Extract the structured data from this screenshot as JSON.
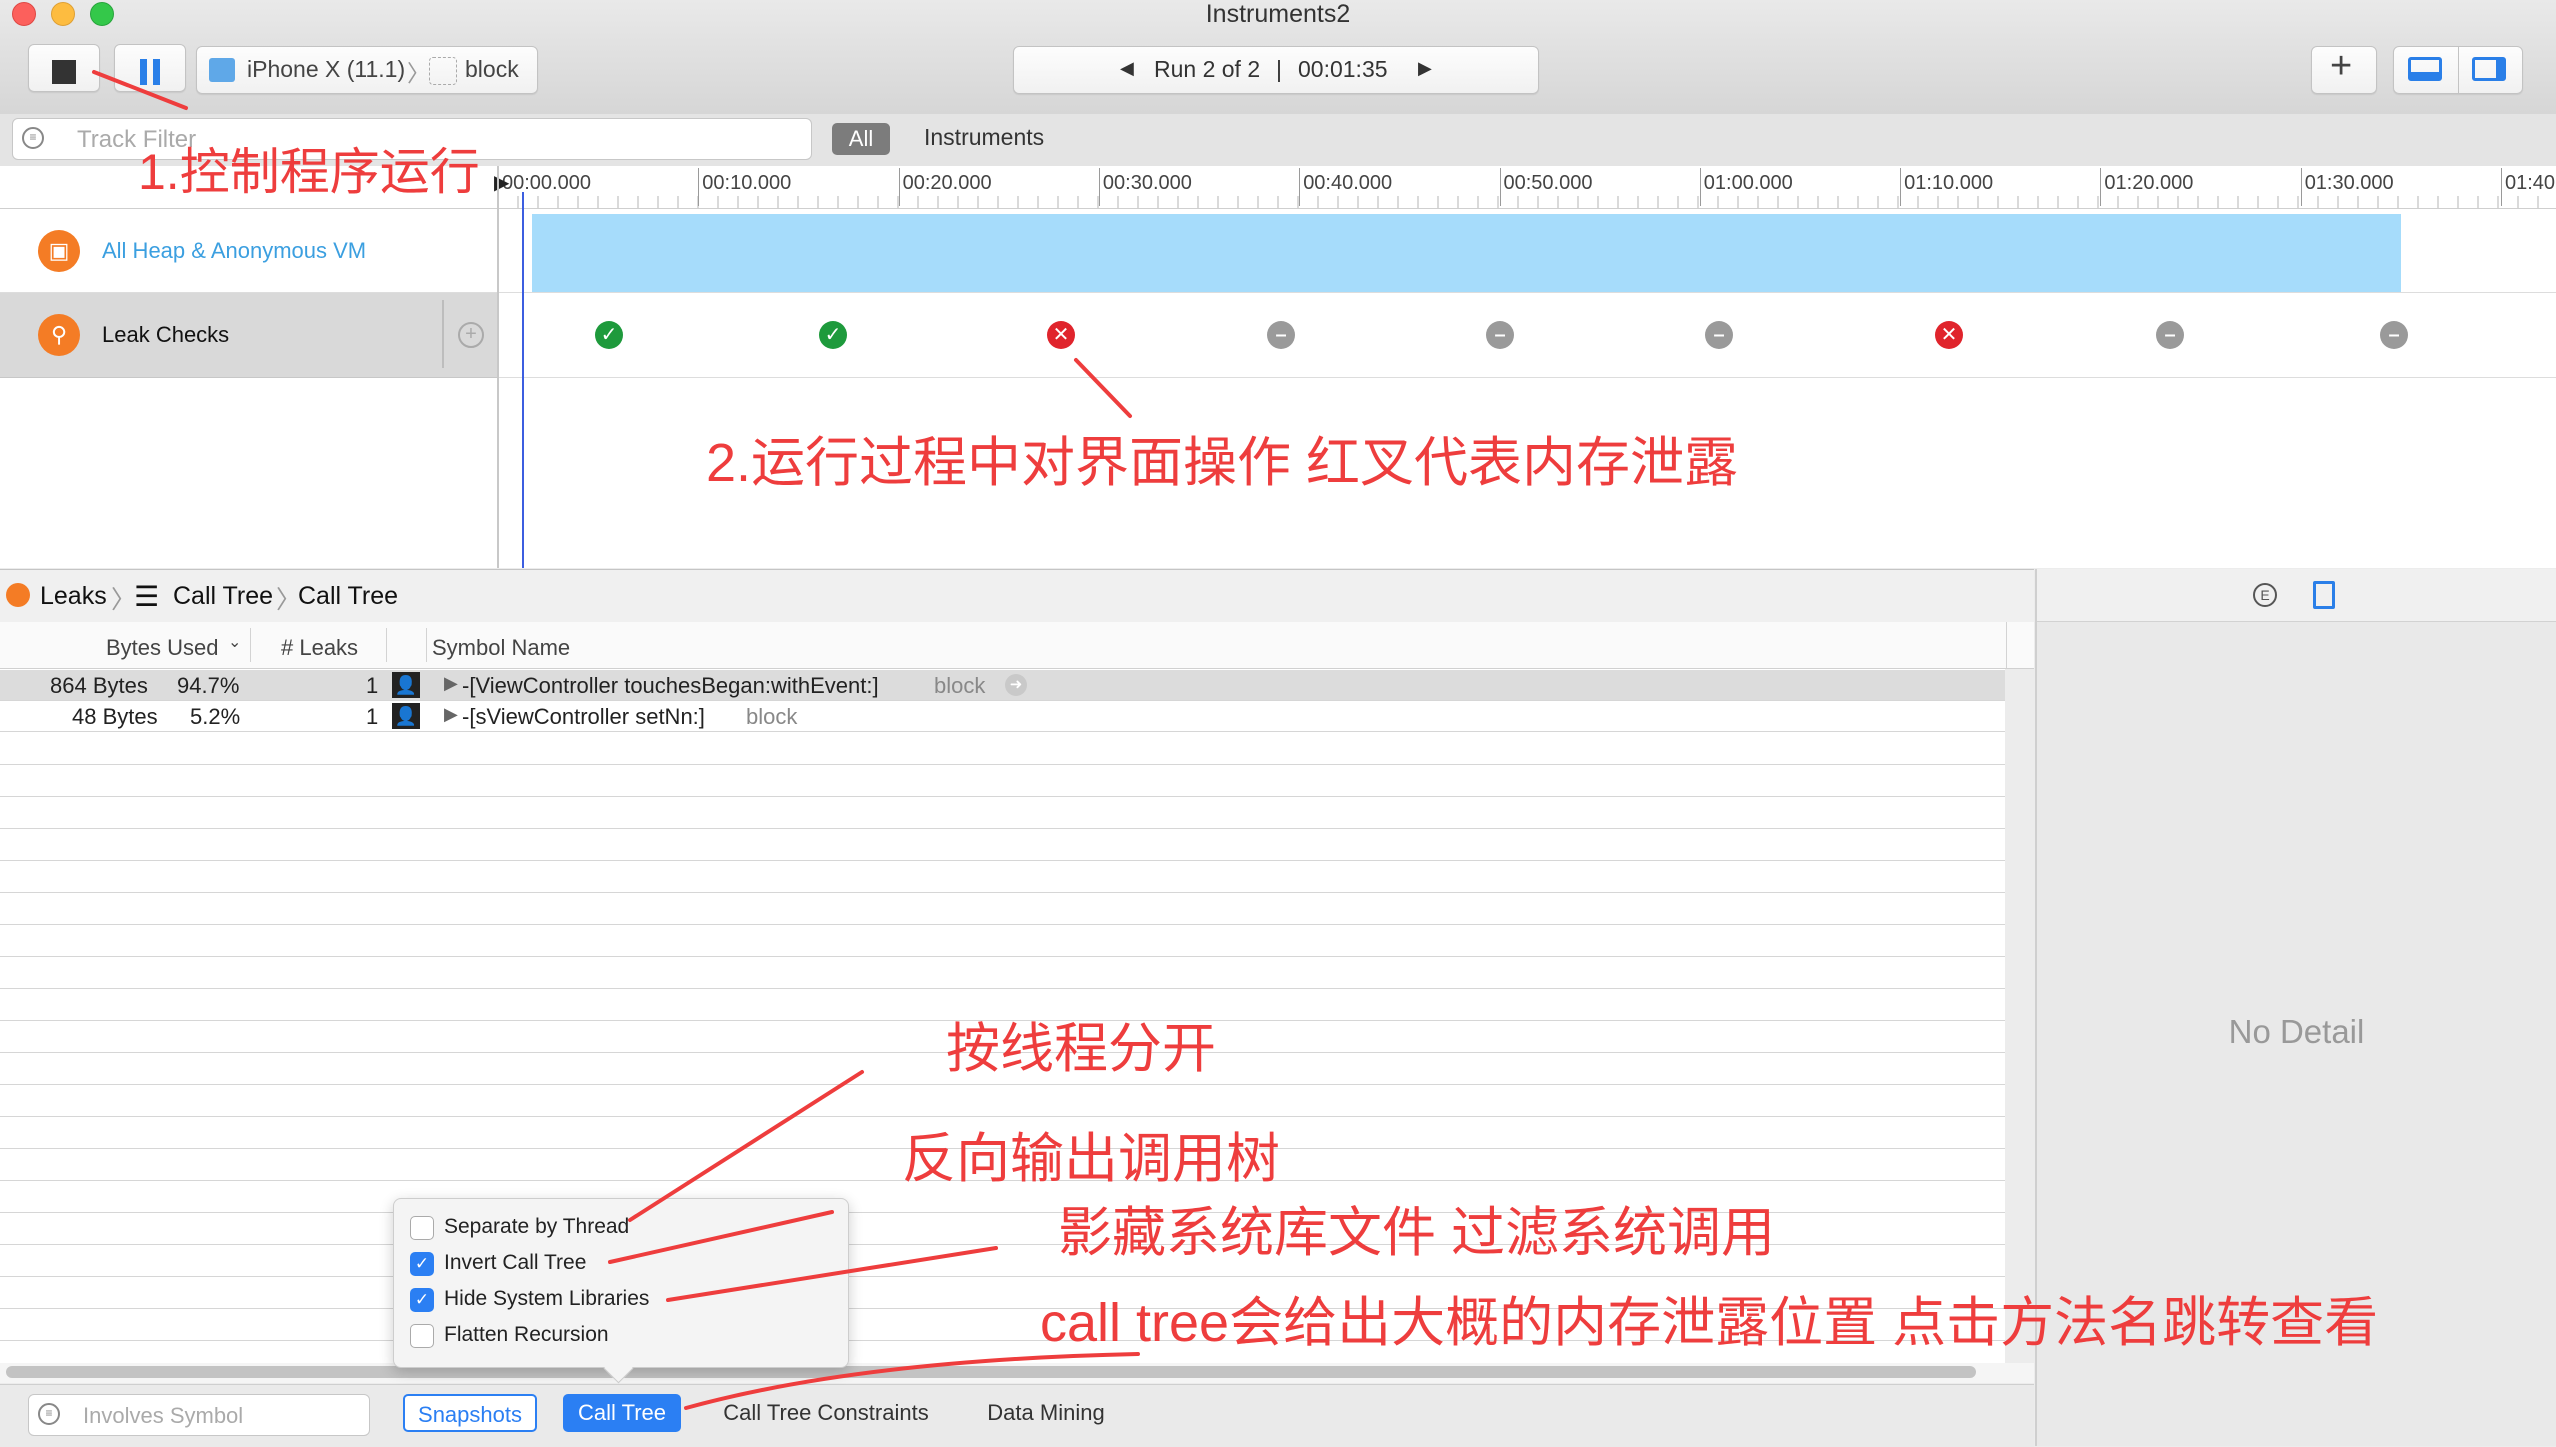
{
  "window": {
    "title": "Instruments2"
  },
  "toolbar": {
    "device": "iPhone X (11.1)",
    "target": "block",
    "run_label": "Run 2 of 2",
    "run_time": "00:01:35"
  },
  "filter_bar": {
    "track_filter_placeholder": "Track Filter",
    "scope_all": "All",
    "scope_instruments": "Instruments"
  },
  "timeline": {
    "ticks": [
      "00:00.000",
      "00:10.000",
      "00:20.000",
      "00:30.000",
      "00:40.000",
      "00:50.000",
      "01:00.000",
      "01:10.000",
      "01:20.000",
      "01:30.000",
      "01:40"
    ]
  },
  "tracks": [
    {
      "name": "All Heap & Anonymous VM",
      "icon": "heap-icon",
      "color": "#a6dcfb"
    },
    {
      "name": "Leak Checks",
      "icon": "leak-icon",
      "checks": [
        "pass",
        "pass",
        "leak",
        "none",
        "none",
        "none",
        "leak",
        "none",
        "none"
      ]
    }
  ],
  "breadcrumb": {
    "items": [
      "Leaks",
      "Call Tree",
      "Call Tree"
    ]
  },
  "table": {
    "columns": [
      "Bytes Used",
      "# Leaks",
      "Symbol Name"
    ],
    "rows": [
      {
        "bytes": "864 Bytes",
        "percent": "94.7%",
        "leaks": "1",
        "symbol": "-[ViewController touchesBegan:withEvent:]",
        "library": "block"
      },
      {
        "bytes": "48 Bytes",
        "percent": "5.2%",
        "leaks": "1",
        "symbol": "-[sViewController setNn:]",
        "library": "block"
      }
    ]
  },
  "inspector": {
    "empty_text": "No Detail",
    "icon_left": "E"
  },
  "call_tree_options": [
    {
      "label": "Separate by Thread",
      "checked": false
    },
    {
      "label": "Invert Call Tree",
      "checked": true
    },
    {
      "label": "Hide System Libraries",
      "checked": true
    },
    {
      "label": "Flatten Recursion",
      "checked": false
    }
  ],
  "bottom_bar": {
    "involves_placeholder": "Involves Symbol",
    "tabs": [
      "Snapshots",
      "Call Tree",
      "Call Tree Constraints",
      "Data Mining"
    ]
  },
  "annotations": {
    "a1": "1.控制程序运行",
    "a2": "2.运行过程中对界面操作 红叉代表内存泄露",
    "a3": "按线程分开",
    "a4": "反向输出调用树",
    "a5": "影藏系统库文件 过滤系统调用",
    "a6": "call tree会给出大概的内存泄露位置 点击方法名跳转查看"
  },
  "colors": {
    "accent": "#2b7ff3",
    "leak": "#e0242c",
    "pass": "#1e9a3c",
    "annotation": "#ee3d3d"
  }
}
